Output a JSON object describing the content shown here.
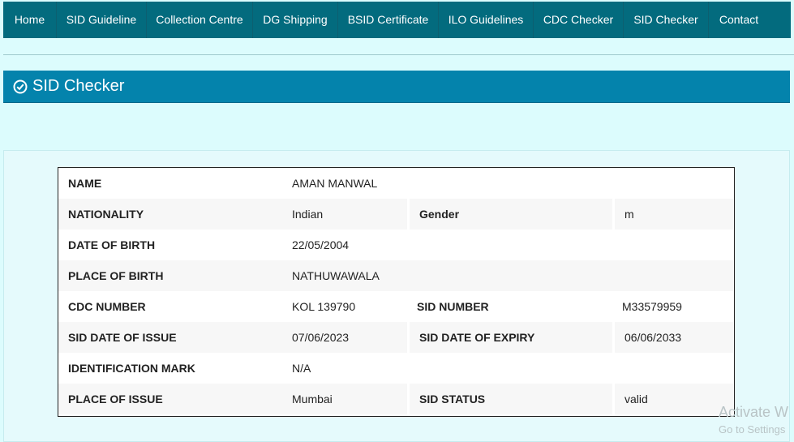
{
  "nav": {
    "items": [
      {
        "label": "Home"
      },
      {
        "label": "SID Guideline"
      },
      {
        "label": "Collection Centre"
      },
      {
        "label": "DG Shipping"
      },
      {
        "label": "BSID Certificate"
      },
      {
        "label": "ILO Guidelines"
      },
      {
        "label": "CDC Checker"
      },
      {
        "label": "SID Checker"
      },
      {
        "label": "Contact"
      }
    ]
  },
  "banner": {
    "title": "SID Checker",
    "icon": "check-circle-icon"
  },
  "record": {
    "name_label": "NAME",
    "name_value": "AMAN MANWAL",
    "nationality_label": "NATIONALITY",
    "nationality_value": "Indian",
    "gender_label": "Gender",
    "gender_value": "m",
    "dob_label": "DATE OF BIRTH",
    "dob_value": "22/05/2004",
    "pob_label": "PLACE OF BIRTH",
    "pob_value": "NATHUWAWALA",
    "cdc_label": "CDC NUMBER",
    "cdc_value": "KOL 139790",
    "sid_label": "SID NUMBER",
    "sid_value": "M33579959",
    "issue_date_label": "SID DATE OF ISSUE",
    "issue_date_value": "07/06/2023",
    "expiry_label": "SID DATE OF EXPIRY",
    "expiry_value": "06/06/2033",
    "idmark_label": "IDENTIFICATION MARK",
    "idmark_value": "N/A",
    "place_issue_label": "PLACE OF ISSUE",
    "place_issue_value": "Mumbai",
    "status_label": "SID STATUS",
    "status_value": "valid"
  },
  "watermark": {
    "line1": "Activate W",
    "line2": "Go to Settings"
  },
  "colors": {
    "nav": "#036b7e",
    "banner": "#0483ac",
    "page_bg": "#dcfcfd"
  }
}
